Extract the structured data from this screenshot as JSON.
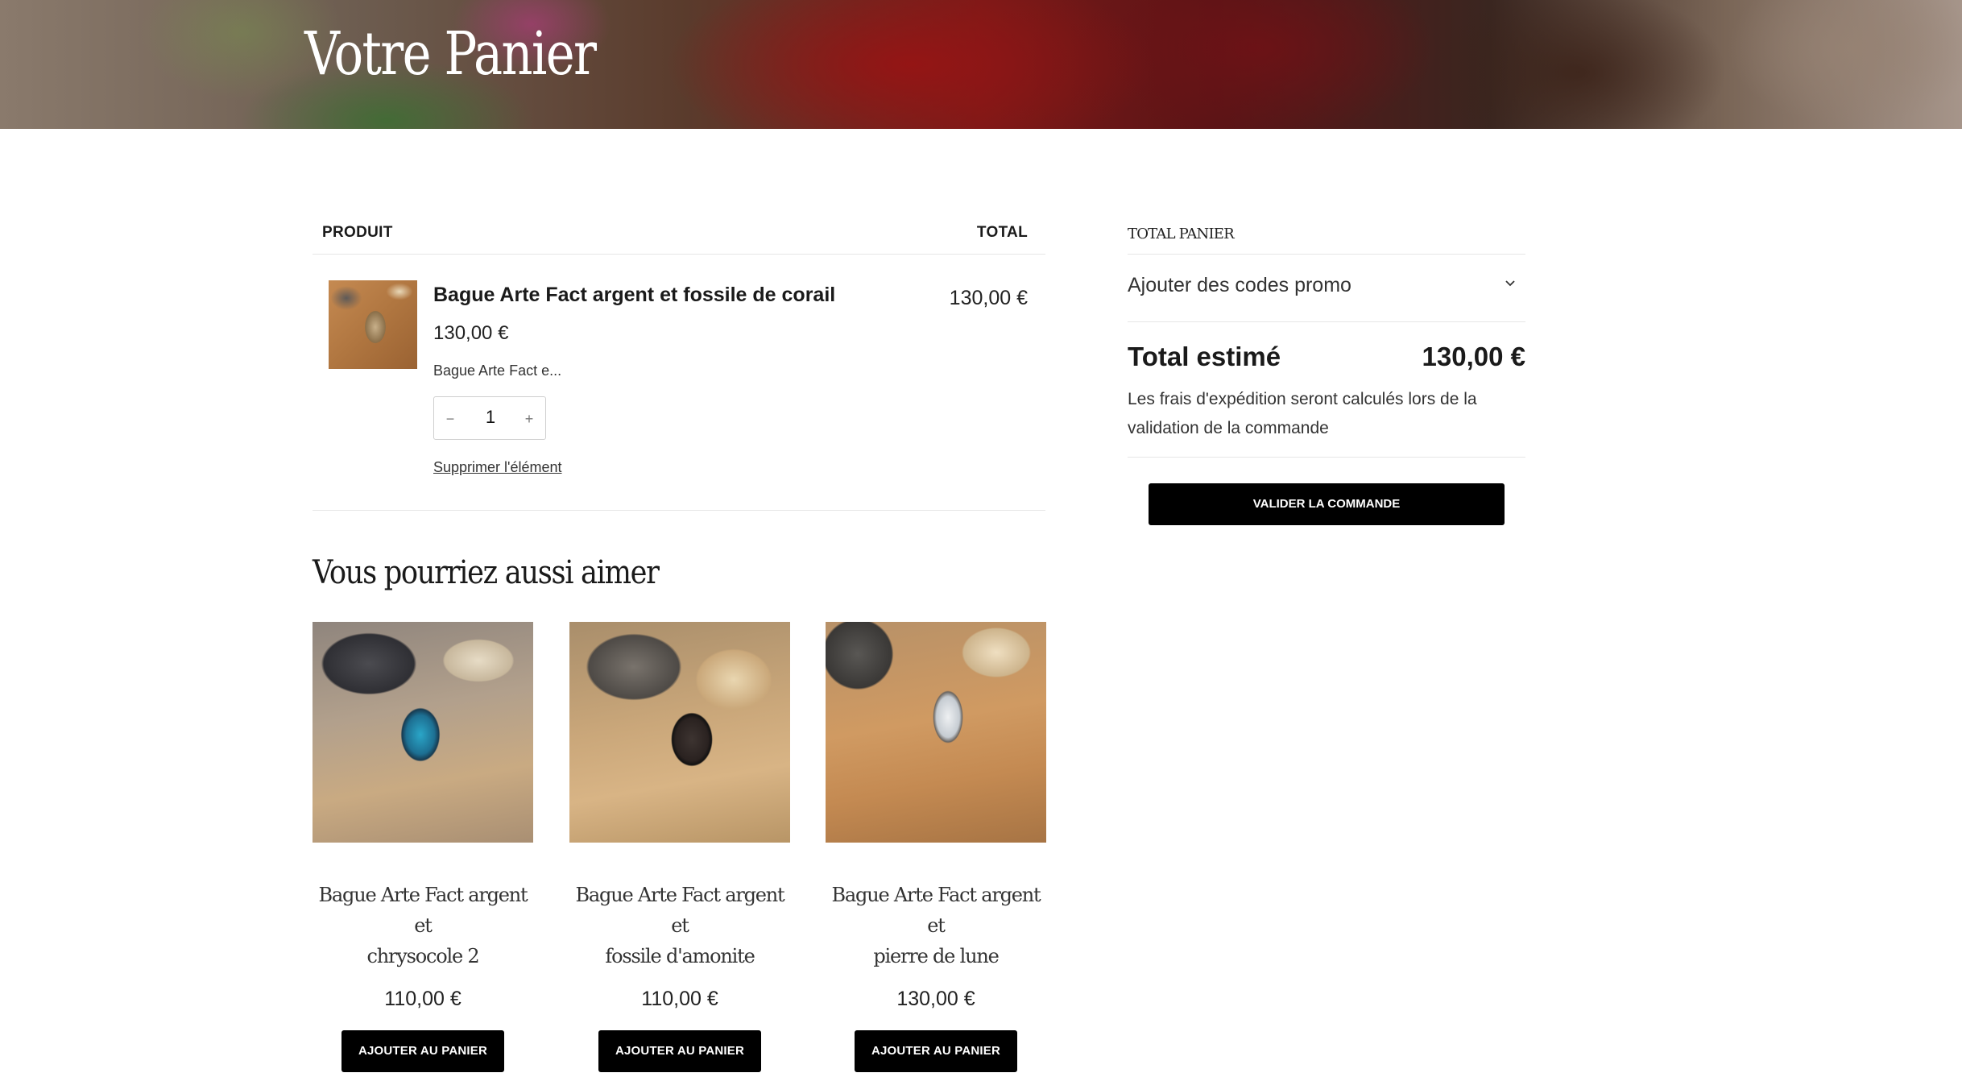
{
  "hero": {
    "title": "Votre Panier"
  },
  "cart": {
    "header": {
      "product": "PRODUIT",
      "total": "TOTAL"
    },
    "item": {
      "name": "Bague Arte Fact argent et fossile de corail",
      "price": "130,00 €",
      "variant": "Bague Arte Fact e...",
      "quantity": "1",
      "minus": "−",
      "plus": "+",
      "remove": "Supprimer l'élément",
      "line_total": "130,00 €"
    }
  },
  "recommendations": {
    "title": "Vous pourriez aussi aimer",
    "products": [
      {
        "name_line1": "Bague Arte Fact argent et",
        "name_line2": "chrysocole 2",
        "price": "110,00 €",
        "button": "AJOUTER AU PANIER"
      },
      {
        "name_line1": "Bague Arte Fact argent et",
        "name_line2": "fossile d'amonite",
        "price": "110,00 €",
        "button": "AJOUTER AU PANIER"
      },
      {
        "name_line1": "Bague Arte Fact argent et",
        "name_line2": "pierre de lune",
        "price": "130,00 €",
        "button": "AJOUTER AU PANIER"
      }
    ]
  },
  "summary": {
    "heading": "TOTAL PANIER",
    "promo_label": "Ajouter des codes promo",
    "promo_icon": "chevron-down-icon",
    "estimated_label": "Total estimé",
    "estimated_value": "130,00 €",
    "shipping_note": "Les frais d'expédition seront calculés lors de la validation de la commande",
    "checkout_button": "VALIDER LA COMMANDE"
  }
}
